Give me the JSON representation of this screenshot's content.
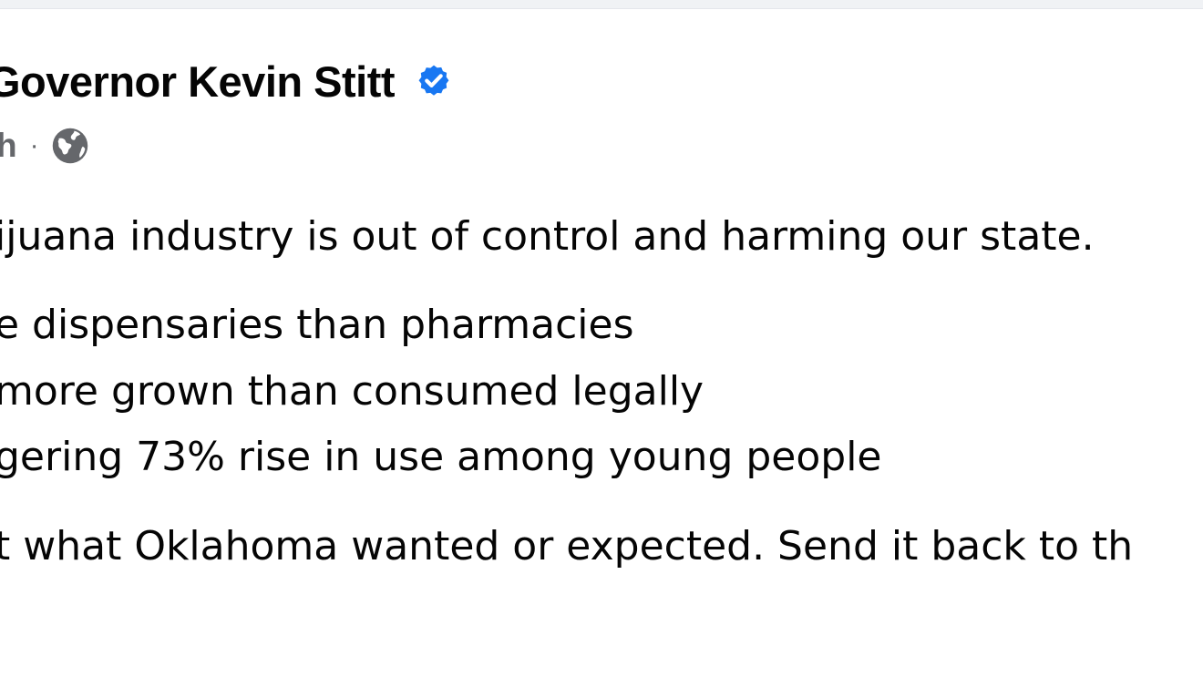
{
  "post": {
    "author_name": "Governor Kevin Stitt",
    "timestamp": "h",
    "separator": "·",
    "icons": {
      "verified": "verified-badge-icon",
      "audience": "globe-icon"
    },
    "colors": {
      "verified_blue": "#1877f2",
      "meta_gray": "#65676b",
      "text": "#050505"
    },
    "lines": [
      "ijuana industry is out of control and harming our state.",
      "e dispensaries than pharmacies",
      "more grown than consumed legally",
      "gering 73% rise in use among young people",
      "t what Oklahoma wanted or expected. Send it back to th"
    ]
  }
}
